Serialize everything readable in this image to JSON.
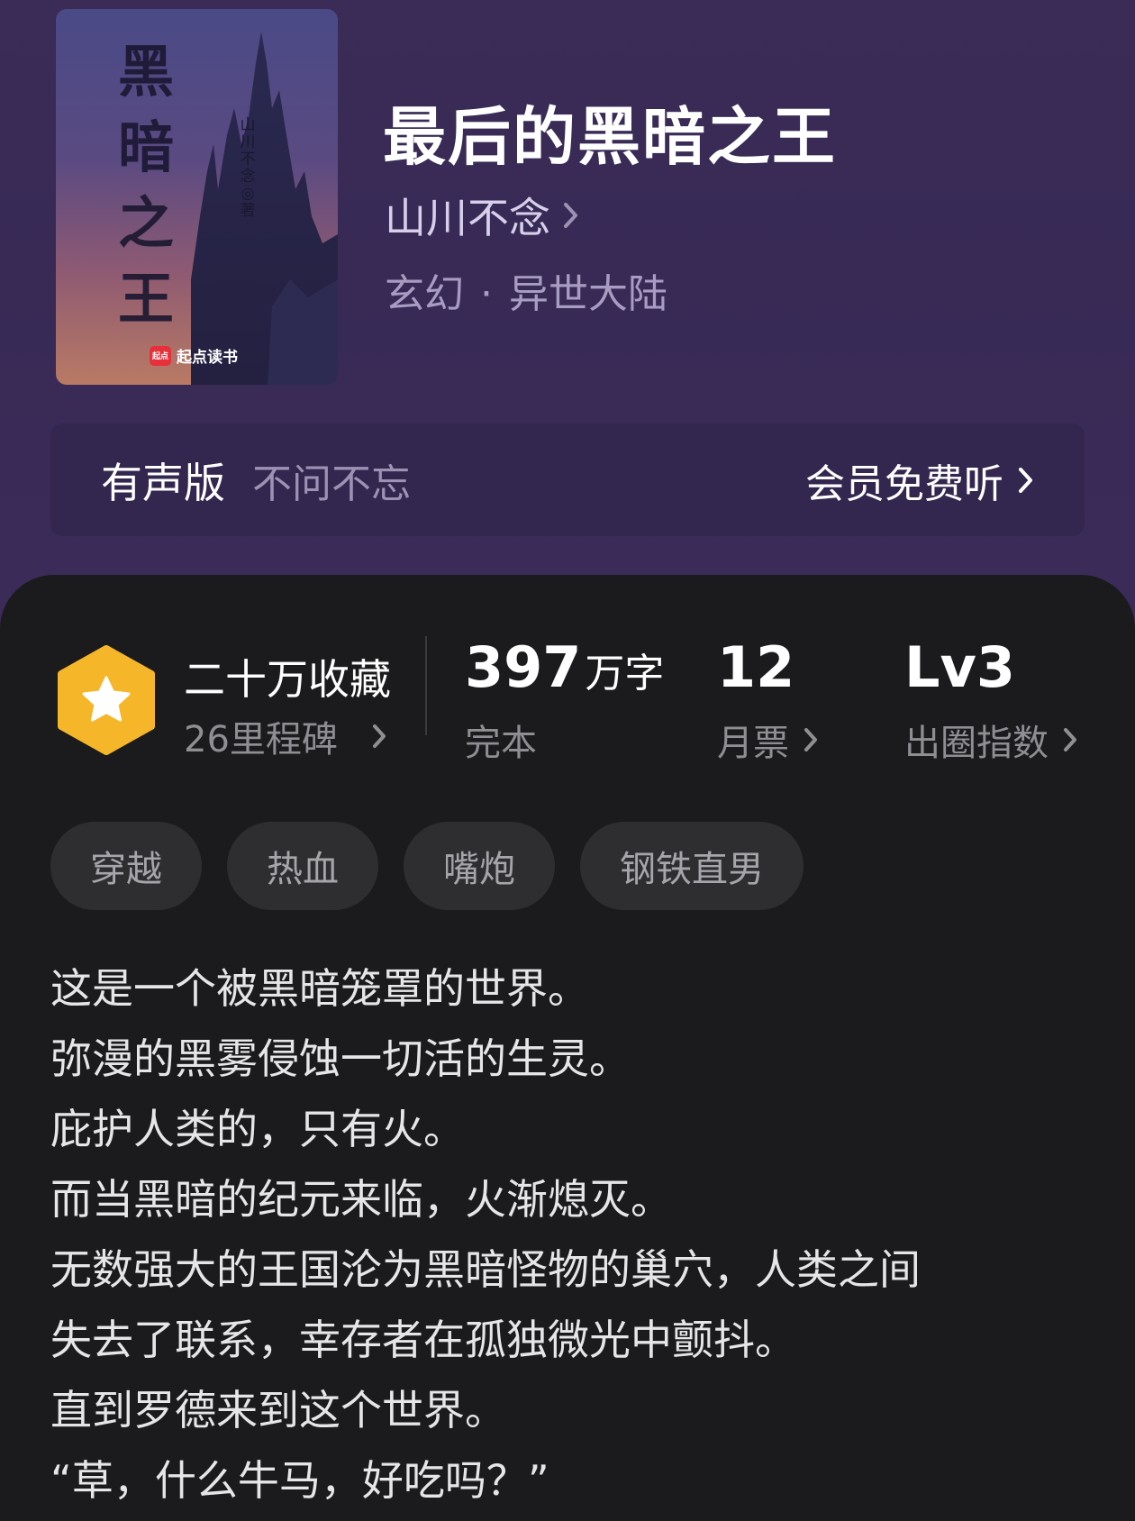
{
  "book": {
    "title": "最后的黑暗之王",
    "author": "山川不念",
    "genre_main": "玄幻",
    "genre_sub": "异世大陆",
    "cover": {
      "title_chars": [
        "黑",
        "暗",
        "之",
        "王"
      ],
      "author_vertical": "山川不念◎著",
      "brand_logo_text": "起点",
      "brand_name": "起点读书"
    }
  },
  "audio": {
    "label": "有声版",
    "name": "不问不忘",
    "cta": "会员免费听"
  },
  "stats": {
    "collections": "二十万收藏",
    "milestones": "26里程碑",
    "word_count": "397",
    "word_unit": "万字",
    "status": "完本",
    "monthly_votes": "12",
    "monthly_votes_label": "月票",
    "level": "Lv3",
    "level_label": "出圈指数"
  },
  "tags": [
    "穿越",
    "热血",
    "嘴炮",
    "钢铁直男"
  ],
  "synopsis": [
    "这是一个被黑暗笼罩的世界。",
    "弥漫的黑雾侵蚀一切活的生灵。",
    "庇护人类的，只有火。",
    "而当黑暗的纪元来临，火渐熄灭。",
    "无数强大的王国沦为黑暗怪物的巢穴，人类之间",
    "失去了联系，幸存者在孤独微光中颤抖。",
    "直到罗德来到这个世界。",
    "“草，什么牛马，好吃吗？”"
  ],
  "colors": {
    "hero_bg": "#3a2b57",
    "audio_bar_bg": "#33264f",
    "content_bg": "#1b1b1d",
    "badge": "#f6b62a",
    "tag_bg": "#2e2e31"
  }
}
